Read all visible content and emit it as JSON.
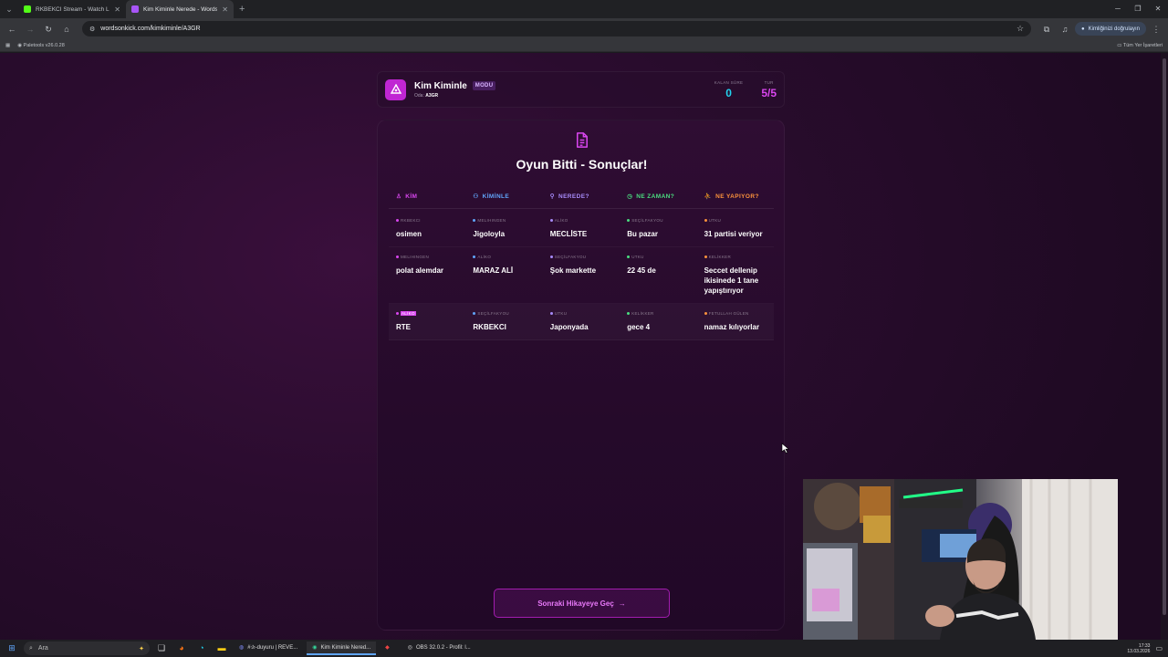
{
  "browser": {
    "tabs": [
      {
        "title": "RKBEKCI Stream - Watch Live o",
        "color": "#53fc18",
        "active": false
      },
      {
        "title": "Kim Kiminle Nerede - Words O",
        "color": "#a855f7",
        "active": true
      }
    ],
    "url": "wordsonkick.com/kimkiminle/A3GR",
    "profile_label": "Kimliğinizi doğrulayın",
    "bookmark": "Paletools v26.0.28",
    "all_bookmarks": "Tüm Yer İşaretleri"
  },
  "header": {
    "title": "Kim Kiminle",
    "mode_badge": "MODU",
    "room_label": "Oda:",
    "room_code": "A3GR",
    "time_label": "KALAN SÜRE",
    "time_value": "0",
    "round_label": "TUR",
    "round_value": "5/5"
  },
  "results": {
    "title": "Oyun Bitti - Sonuçlar!",
    "columns": [
      {
        "label": "KİM",
        "color": "#d946ef",
        "icon": "person-icon"
      },
      {
        "label": "KİMİNLE",
        "color": "#60a5fa",
        "icon": "people-icon"
      },
      {
        "label": "NEREDE?",
        "color": "#a78bfa",
        "icon": "location-pin-icon"
      },
      {
        "label": "NE ZAMAN?",
        "color": "#4ade80",
        "icon": "clock-icon"
      },
      {
        "label": "NE YAPIYOR?",
        "color": "#fb923c",
        "icon": "running-icon"
      }
    ],
    "rows": [
      {
        "cells": [
          {
            "author": "RKBEKCI",
            "answer": "osimen"
          },
          {
            "author": "MELIHINGEN",
            "answer": "Jigoloyla"
          },
          {
            "author": "ALİKO",
            "answer": "MECLİSTE"
          },
          {
            "author": "SEÇİLFAKYOU",
            "answer": "Bu pazar"
          },
          {
            "author": "UTKU",
            "answer": "31 partisi veriyor"
          }
        ]
      },
      {
        "cells": [
          {
            "author": "MELIHINGEN",
            "answer": "polat alemdar"
          },
          {
            "author": "ALİKO",
            "answer": "MARAZ ALİ"
          },
          {
            "author": "SEÇİLFAKYOU",
            "answer": "Şok markette"
          },
          {
            "author": "UTKU",
            "answer": "22 45 de"
          },
          {
            "author": "KELİKKER",
            "answer": "Seccet dellenip ikisinede 1 tane yapıştırıyor"
          }
        ]
      },
      {
        "cells": [
          {
            "author": "ALİKO",
            "answer": "RTE"
          },
          {
            "author": "SEÇİLFAKYOU",
            "answer": "RKBEKCI"
          },
          {
            "author": "UTKU",
            "answer": "Japonyada"
          },
          {
            "author": "KELİKKER",
            "answer": "gece 4"
          },
          {
            "author": "FETULLAH GÜLEN",
            "answer": "namaz kılıyorlar"
          }
        ]
      }
    ],
    "next_button": "Sonraki Hikayeye Geç"
  },
  "taskbar": {
    "search_placeholder": "Ara",
    "apps": [
      {
        "label": "#✰-duyuru | REVE..."
      },
      {
        "label": "Kim Kiminle Nered..."
      },
      {
        "label": ""
      },
      {
        "label": "OBS 32.0.2 - Profil: l..."
      }
    ],
    "time": "17:33",
    "date": "13.03.2026"
  }
}
